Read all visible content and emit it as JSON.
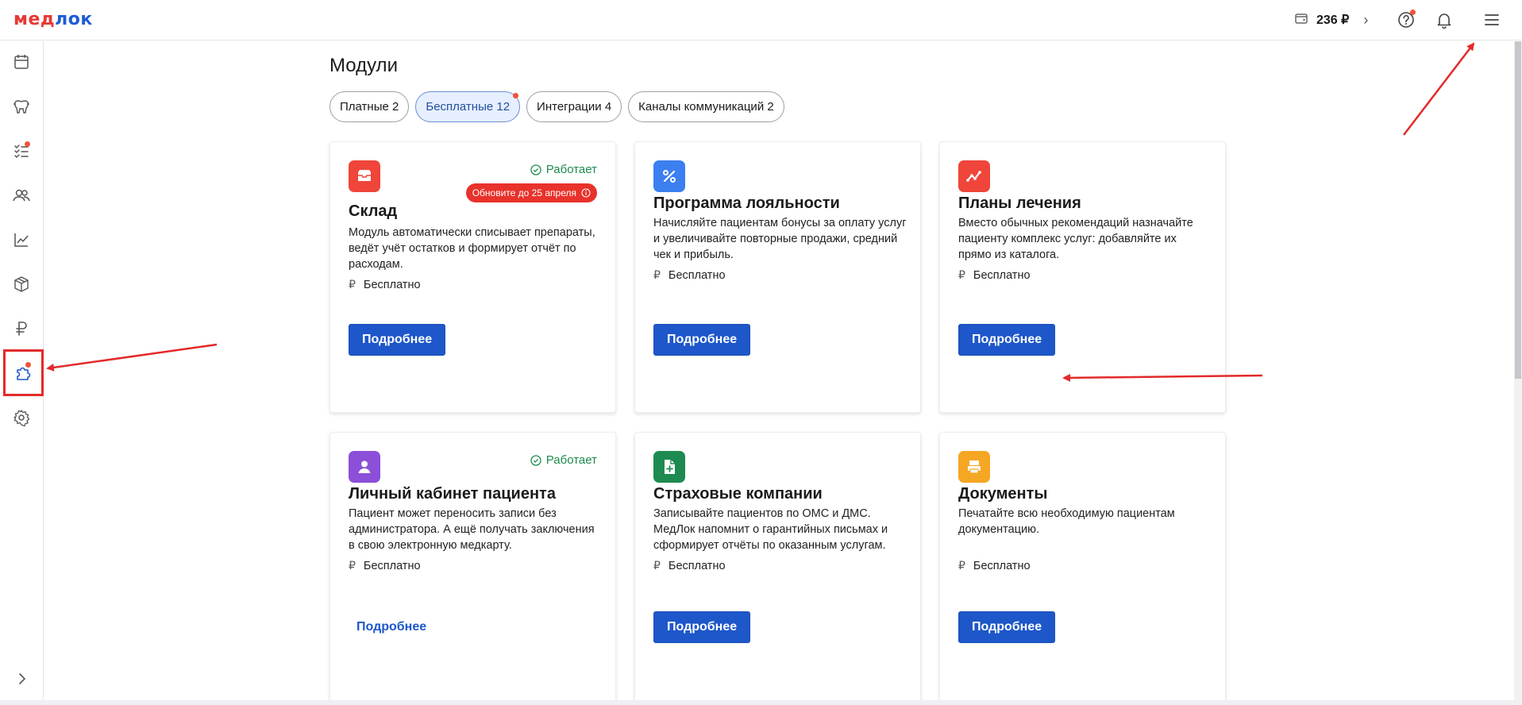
{
  "header": {
    "logo_part1": "мед",
    "logo_part2": "лок",
    "balance": "236 ₽",
    "balance_chevron": "›"
  },
  "page": {
    "title": "Модули"
  },
  "tabs": [
    {
      "label": "Платные 2"
    },
    {
      "label": "Бесплатные 12"
    },
    {
      "label": "Интеграции 4"
    },
    {
      "label": "Каналы коммуникаций 2"
    }
  ],
  "cards": [
    {
      "title": "Склад",
      "description": "Модуль автоматически списывает препараты, ведёт учёт остатков и формирует отчёт по расходам.",
      "status": "Работает",
      "update_badge": "Обновите до 25 апреля",
      "price": "Бесплатно",
      "button": "Подробнее",
      "icon_color": "#f0453a"
    },
    {
      "title": "Программа лояльности",
      "description": "Начисляйте пациентам бонусы за оплату услуг и увеличивайте повторные продажи, средний чек и прибыль.",
      "price": "Бесплатно",
      "button": "Подробнее",
      "icon_color": "#3b7ff0"
    },
    {
      "title": "Планы лечения",
      "description": "Вместо обычных рекомендаций назначайте пациенту комплекс услуг: добавляйте их прямо из каталога.",
      "price": "Бесплатно",
      "button": "Подробнее",
      "icon_color": "#f0453a"
    },
    {
      "title": "Личный кабинет пациента",
      "description": "Пациент может переносить записи без администратора. А ещё получать заключения в свою электронную медкарту.",
      "status": "Работает",
      "price": "Бесплатно",
      "button": "Подробнее",
      "icon_color": "#8b4fd8"
    },
    {
      "title": "Страховые компании",
      "description": "Записывайте пациентов по ОМС и ДМС. МедЛок напомнит о гарантийных письмах и сформирует отчёты по оказанным услугам.",
      "price": "Бесплатно",
      "button": "Подробнее",
      "icon_color": "#1e8a4f"
    },
    {
      "title": "Документы",
      "description": "Печатайте всю необходимую пациентам документацию.",
      "price": "Бесплатно",
      "button": "Подробнее",
      "icon_color": "#f5a623"
    }
  ],
  "icons": {
    "sidebar": [
      "calendar-icon",
      "tooth-icon",
      "tasks-icon",
      "patients-icon",
      "analytics-icon",
      "warehouse-box-icon",
      "ruble-icon",
      "puzzle-modules-icon",
      "settings-gear-icon",
      "expand-chevron-icon"
    ],
    "top": [
      "wallet-icon",
      "help-icon",
      "bell-icon",
      "menu-icon"
    ]
  },
  "colors": {
    "brand_red": "#e53935",
    "brand_blue": "#1e5bd6",
    "primary_button": "#1d57c9",
    "status_green": "#1f8a4c",
    "annotation_red": "#e22a2a"
  }
}
